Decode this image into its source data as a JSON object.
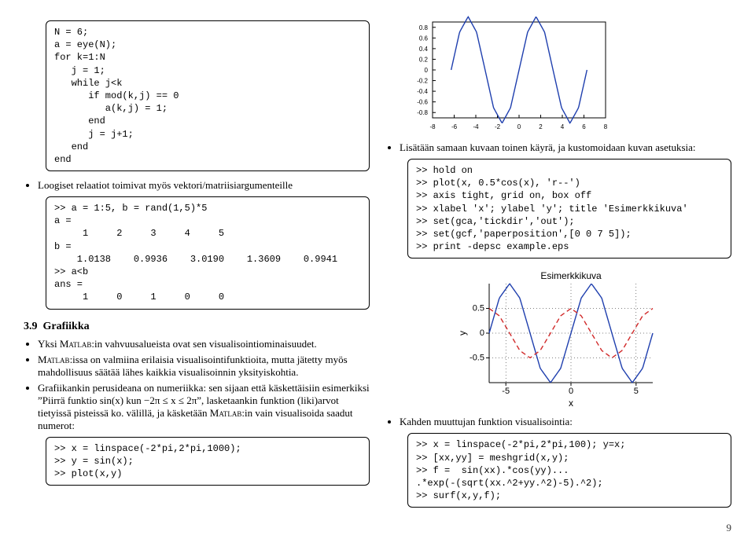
{
  "left": {
    "code1": "N = 6;\na = eye(N);\nfor k=1:N\n   j = 1;\n   while j<k\n      if mod(k,j) == 0\n         a(k,j) = 1;\n      end\n      j = j+1;\n   end\nend",
    "bullet1": "Loogiset relaatiot toimivat myös vektori/matriisiargumenteille",
    "code2": ">> a = 1:5, b = rand(1,5)*5\na =\n     1     2     3     4     5\nb =\n    1.0138    0.9936    3.0190    1.3609    0.9941\n>> a<b\nans =\n     1     0     1     0     0",
    "sec_num": "3.9",
    "sec_title": "Grafiikka",
    "bullet_g1a": "Yksi ",
    "bullet_g1b": ":in vahvuusalueista ovat sen visualisointiominaisuudet.",
    "bullet_g2a": "",
    "bullet_g2b": ":issa on valmiina erilaisia visualisointifunktioita, mutta jätetty myös mahdollisuus säätää lähes kaikkia visualisoinnin yksityiskohtia.",
    "bullet_g3a": "Grafiikankin perusideana on numeriikka: sen sijaan että käskettäisiin esimerkiksi ”Piirrä funktio sin(x) kun −2π ≤ x ≤ 2π”, lasketaankin funktion (liki)arvot tietyissä pisteissä ko. välillä, ja käsketään ",
    "bullet_g3b": ":in vain visualisoida saadut numerot:",
    "matlab": "Matlab",
    "code3": ">> x = linspace(-2*pi,2*pi,1000);\n>> y = sin(x);\n>> plot(x,y)"
  },
  "right": {
    "bullet1": "Lisätään samaan kuvaan toinen käyrä, ja kustomoidaan kuvan asetuksia:",
    "code1": ">> hold on\n>> plot(x, 0.5*cos(x), 'r--')\n>> axis tight, grid on, box off\n>> xlabel 'x'; ylabel 'y'; title 'Esimerkkikuva'\n>> set(gca,'tickdir','out');\n>> set(gcf,'paperposition',[0 0 7 5]);\n>> print -depsc example.eps",
    "bullet2": "Kahden muuttujan funktion visualisointia:",
    "code2": ">> x = linspace(-2*pi,2*pi,100); y=x;\n>> [xx,yy] = meshgrid(x,y);\n>> f =  sin(xx).*cos(yy)...\n.*exp(-(sqrt(xx.^2+yy.^2)-5).^2);\n>> surf(x,y,f);"
  },
  "chart_data": [
    {
      "type": "line",
      "title": "",
      "xlabel": "",
      "ylabel": "",
      "xlim": [
        -8,
        8
      ],
      "ylim": [
        -0.9,
        0.9
      ],
      "xticks": [
        -8,
        -6,
        -4,
        -2,
        0,
        2,
        4,
        6,
        8
      ],
      "yticks": [
        -0.8,
        -0.6,
        -0.4,
        -0.2,
        0,
        0.2,
        0.4,
        0.6,
        0.8
      ],
      "series": [
        {
          "name": "sin(x)",
          "color": "#1f3fae",
          "x": [
            -6.28,
            -5.5,
            -4.71,
            -3.93,
            -3.14,
            -2.36,
            -1.57,
            -0.79,
            0,
            0.79,
            1.57,
            2.36,
            3.14,
            3.93,
            4.71,
            5.5,
            6.28
          ],
          "y": [
            0,
            0.71,
            1,
            0.71,
            0,
            -0.71,
            -1,
            -0.71,
            0,
            0.71,
            1,
            0.71,
            0,
            -0.71,
            -1,
            -0.71,
            0
          ]
        }
      ]
    },
    {
      "type": "line",
      "title": "Esimerkkikuva",
      "xlabel": "x",
      "ylabel": "y",
      "xlim": [
        -6.28,
        6.28
      ],
      "ylim": [
        -1,
        1
      ],
      "xticks": [
        -5,
        0,
        5
      ],
      "yticks": [
        -0.5,
        0,
        0.5
      ],
      "grid": true,
      "series": [
        {
          "name": "sin(x)",
          "color": "#1f3fae",
          "style": "solid",
          "x": [
            -6.28,
            -5.5,
            -4.71,
            -3.93,
            -3.14,
            -2.36,
            -1.57,
            -0.79,
            0,
            0.79,
            1.57,
            2.36,
            3.14,
            3.93,
            4.71,
            5.5,
            6.28
          ],
          "y": [
            0,
            0.71,
            1,
            0.71,
            0,
            -0.71,
            -1,
            -0.71,
            0,
            0.71,
            1,
            0.71,
            0,
            -0.71,
            -1,
            -0.71,
            0
          ]
        },
        {
          "name": "0.5*cos(x)",
          "color": "#d12a2a",
          "style": "dashed",
          "x": [
            -6.28,
            -5.5,
            -4.71,
            -3.93,
            -3.14,
            -2.36,
            -1.57,
            -0.79,
            0,
            0.79,
            1.57,
            2.36,
            3.14,
            3.93,
            4.71,
            5.5,
            6.28
          ],
          "y": [
            0.5,
            0.35,
            0,
            -0.35,
            -0.5,
            -0.35,
            0,
            0.35,
            0.5,
            0.35,
            0,
            -0.35,
            -0.5,
            -0.35,
            0,
            0.35,
            0.5
          ]
        }
      ]
    }
  ],
  "page_number": "9"
}
